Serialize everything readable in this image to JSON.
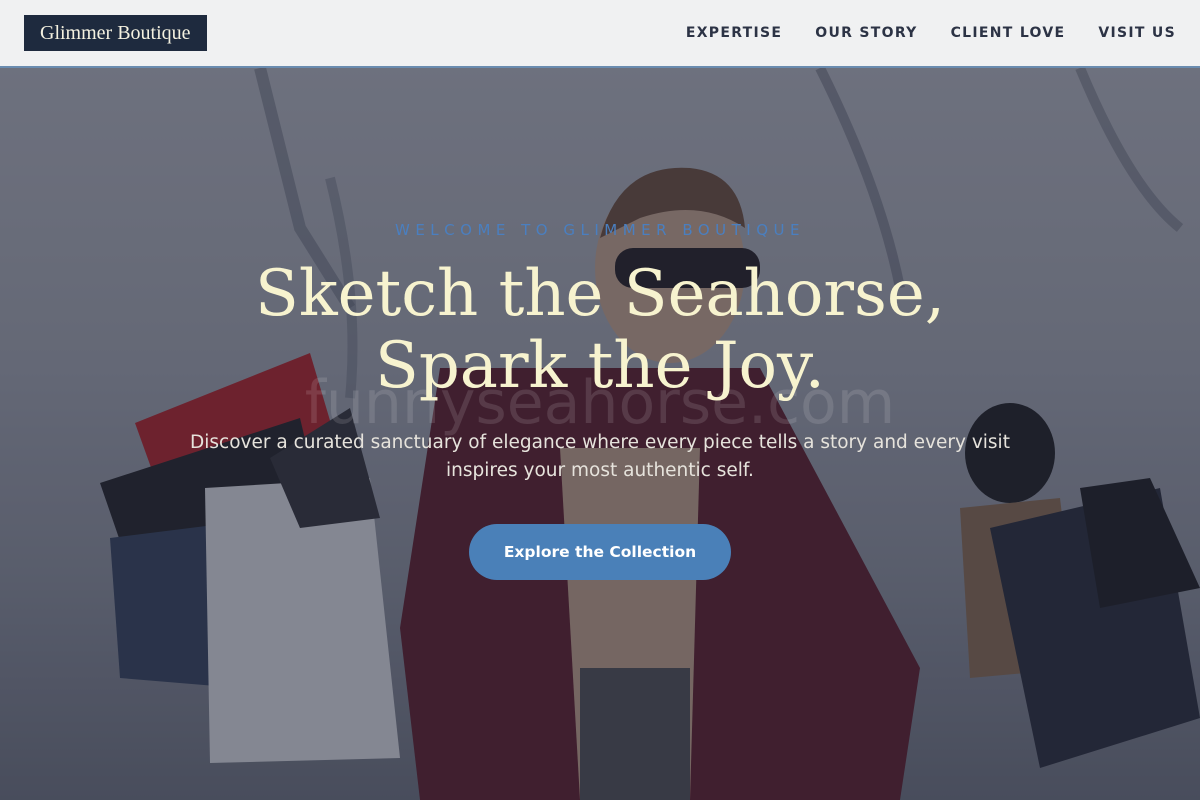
{
  "brand": {
    "name": "Glimmer Boutique"
  },
  "nav": {
    "items": [
      {
        "label": "EXPERTISE"
      },
      {
        "label": "OUR STORY"
      },
      {
        "label": "CLIENT LOVE"
      },
      {
        "label": "VISIT US"
      }
    ]
  },
  "hero": {
    "eyebrow": "WELCOME TO GLIMMER BOUTIQUE",
    "headline_line1": "Sketch the Seahorse,",
    "headline_line2": "Spark the Joy.",
    "subtext": "Discover a curated sanctuary of elegance where every piece tells a story and every visit inspires your most authentic self.",
    "cta_label": "Explore the Collection",
    "watermark": "funnyseahorse.com"
  },
  "colors": {
    "navbar_bg": "#f0f1f2",
    "logo_bg": "#1e2a3e",
    "headline": "#f7f3cf",
    "eyebrow": "#4a7fc0",
    "cta_bg": "#4a80b8"
  }
}
